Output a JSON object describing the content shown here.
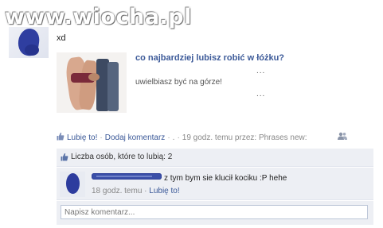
{
  "watermark": "www.wiocha.pl",
  "post": {
    "status_text": "xd",
    "link_title": "co najbardziej lubisz robić w łóżku?",
    "link_description": "uwielbiasz być na górze!",
    "ellipsis_1": "...",
    "ellipsis_2": "..."
  },
  "actions": {
    "like": "Lubię to!",
    "comment": "Dodaj komentarz",
    "dot": ".",
    "timestamp": "19 godz. temu przez: Phrases new:"
  },
  "likes": {
    "text": "Liczba osób, które to lubią: 2"
  },
  "comment": {
    "text": "z tym bym sie klucił kociku :P hehe",
    "time": "18 godz. temu",
    "like": "Lubię to!"
  },
  "composer": {
    "placeholder": "Napisz komentarz..."
  },
  "colors": {
    "link": "#3b5998",
    "panel": "#edeff4",
    "muted": "#888888"
  }
}
